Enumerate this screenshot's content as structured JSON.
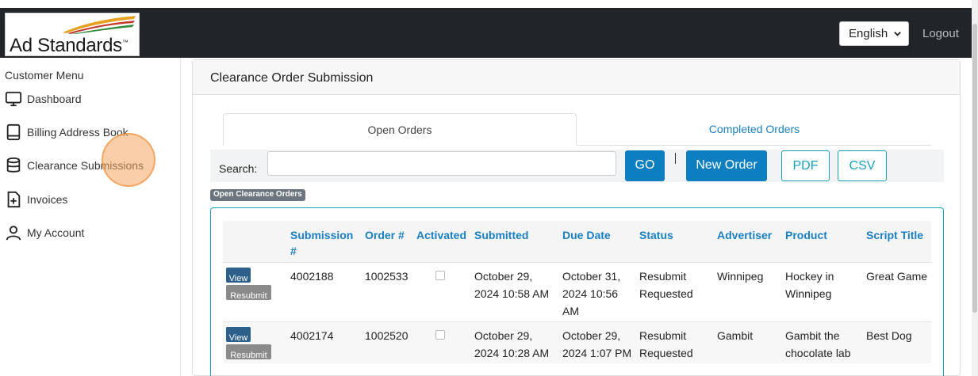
{
  "header": {
    "logo_text": "Ad Standards",
    "logo_tm": "™",
    "language": {
      "selected": "English"
    },
    "logout_label": "Logout"
  },
  "sidebar": {
    "title": "Customer Menu",
    "items": [
      {
        "label": "Dashboard",
        "icon": "monitor-icon"
      },
      {
        "label": "Billing Address Book",
        "icon": "book-icon"
      },
      {
        "label": "Clearance Submissions",
        "icon": "database-icon"
      },
      {
        "label": "Invoices",
        "icon": "file-plus-icon"
      },
      {
        "label": "My Account",
        "icon": "user-icon"
      }
    ]
  },
  "main": {
    "card_title": "Clearance Order Submission",
    "tabs": [
      {
        "label": "Open Orders",
        "active": true
      },
      {
        "label": "Completed Orders",
        "active": false
      }
    ],
    "search": {
      "label": "Search:",
      "value": "",
      "go_label": "GO",
      "separator": "|",
      "new_order_label": "New Order",
      "pdf_label": "PDF",
      "csv_label": "CSV"
    },
    "badge": "Open Clearance Orders",
    "table": {
      "columns": [
        "",
        "Submission #",
        "Order #",
        "Activated",
        "Submitted",
        "Due Date",
        "Status",
        "Advertiser",
        "Product",
        "Script Title"
      ],
      "view_label": "View",
      "resubmit_label": "Resubmit",
      "rows": [
        {
          "submission": "4002188",
          "order": "1002533",
          "activated": false,
          "submitted": "October 29, 2024 10:58 AM",
          "due": "October 31, 2024 10:56 AM",
          "status": "Resubmit Requested",
          "advertiser": "Winnipeg",
          "product": "Hockey in Winnipeg",
          "script_title": "Great Game"
        },
        {
          "submission": "4002174",
          "order": "1002520",
          "activated": false,
          "submitted": "October 29, 2024 10:28 AM",
          "due": "October 29, 2024 1:07 PM",
          "status": "Resubmit Requested",
          "advertiser": "Gambit",
          "product": "Gambit the chocolate lab",
          "script_title": "Best Dog"
        }
      ]
    }
  },
  "colors": {
    "header_bg": "#212529",
    "primary": "#0d7fc1",
    "outline": "#17a2b8",
    "click_indicator": "#f6a660"
  }
}
